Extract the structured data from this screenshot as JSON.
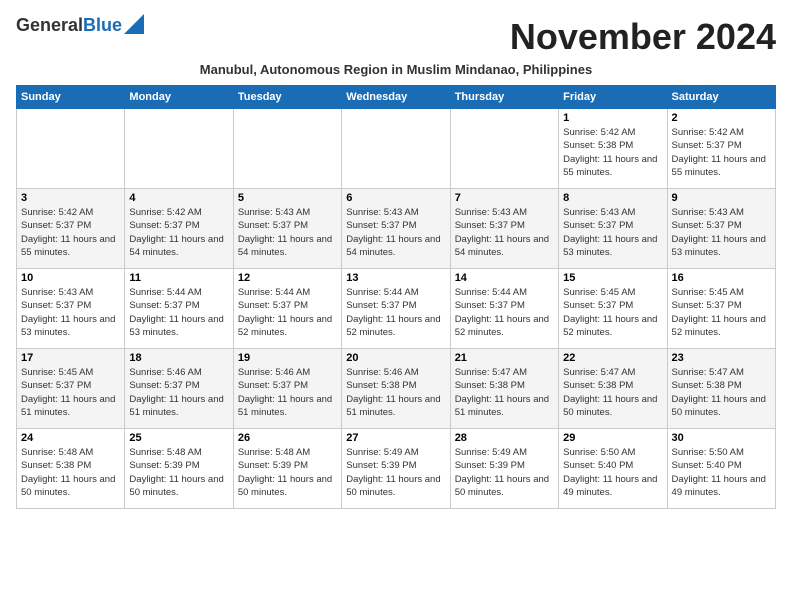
{
  "header": {
    "logo_line1": "General",
    "logo_line2": "Blue",
    "month_title": "November 2024",
    "subtitle": "Manubul, Autonomous Region in Muslim Mindanao, Philippines"
  },
  "days_of_week": [
    "Sunday",
    "Monday",
    "Tuesday",
    "Wednesday",
    "Thursday",
    "Friday",
    "Saturday"
  ],
  "weeks": [
    [
      {
        "day": "",
        "info": ""
      },
      {
        "day": "",
        "info": ""
      },
      {
        "day": "",
        "info": ""
      },
      {
        "day": "",
        "info": ""
      },
      {
        "day": "",
        "info": ""
      },
      {
        "day": "1",
        "info": "Sunrise: 5:42 AM\nSunset: 5:38 PM\nDaylight: 11 hours and 55 minutes."
      },
      {
        "day": "2",
        "info": "Sunrise: 5:42 AM\nSunset: 5:37 PM\nDaylight: 11 hours and 55 minutes."
      }
    ],
    [
      {
        "day": "3",
        "info": "Sunrise: 5:42 AM\nSunset: 5:37 PM\nDaylight: 11 hours and 55 minutes."
      },
      {
        "day": "4",
        "info": "Sunrise: 5:42 AM\nSunset: 5:37 PM\nDaylight: 11 hours and 54 minutes."
      },
      {
        "day": "5",
        "info": "Sunrise: 5:43 AM\nSunset: 5:37 PM\nDaylight: 11 hours and 54 minutes."
      },
      {
        "day": "6",
        "info": "Sunrise: 5:43 AM\nSunset: 5:37 PM\nDaylight: 11 hours and 54 minutes."
      },
      {
        "day": "7",
        "info": "Sunrise: 5:43 AM\nSunset: 5:37 PM\nDaylight: 11 hours and 54 minutes."
      },
      {
        "day": "8",
        "info": "Sunrise: 5:43 AM\nSunset: 5:37 PM\nDaylight: 11 hours and 53 minutes."
      },
      {
        "day": "9",
        "info": "Sunrise: 5:43 AM\nSunset: 5:37 PM\nDaylight: 11 hours and 53 minutes."
      }
    ],
    [
      {
        "day": "10",
        "info": "Sunrise: 5:43 AM\nSunset: 5:37 PM\nDaylight: 11 hours and 53 minutes."
      },
      {
        "day": "11",
        "info": "Sunrise: 5:44 AM\nSunset: 5:37 PM\nDaylight: 11 hours and 53 minutes."
      },
      {
        "day": "12",
        "info": "Sunrise: 5:44 AM\nSunset: 5:37 PM\nDaylight: 11 hours and 52 minutes."
      },
      {
        "day": "13",
        "info": "Sunrise: 5:44 AM\nSunset: 5:37 PM\nDaylight: 11 hours and 52 minutes."
      },
      {
        "day": "14",
        "info": "Sunrise: 5:44 AM\nSunset: 5:37 PM\nDaylight: 11 hours and 52 minutes."
      },
      {
        "day": "15",
        "info": "Sunrise: 5:45 AM\nSunset: 5:37 PM\nDaylight: 11 hours and 52 minutes."
      },
      {
        "day": "16",
        "info": "Sunrise: 5:45 AM\nSunset: 5:37 PM\nDaylight: 11 hours and 52 minutes."
      }
    ],
    [
      {
        "day": "17",
        "info": "Sunrise: 5:45 AM\nSunset: 5:37 PM\nDaylight: 11 hours and 51 minutes."
      },
      {
        "day": "18",
        "info": "Sunrise: 5:46 AM\nSunset: 5:37 PM\nDaylight: 11 hours and 51 minutes."
      },
      {
        "day": "19",
        "info": "Sunrise: 5:46 AM\nSunset: 5:37 PM\nDaylight: 11 hours and 51 minutes."
      },
      {
        "day": "20",
        "info": "Sunrise: 5:46 AM\nSunset: 5:38 PM\nDaylight: 11 hours and 51 minutes."
      },
      {
        "day": "21",
        "info": "Sunrise: 5:47 AM\nSunset: 5:38 PM\nDaylight: 11 hours and 51 minutes."
      },
      {
        "day": "22",
        "info": "Sunrise: 5:47 AM\nSunset: 5:38 PM\nDaylight: 11 hours and 50 minutes."
      },
      {
        "day": "23",
        "info": "Sunrise: 5:47 AM\nSunset: 5:38 PM\nDaylight: 11 hours and 50 minutes."
      }
    ],
    [
      {
        "day": "24",
        "info": "Sunrise: 5:48 AM\nSunset: 5:38 PM\nDaylight: 11 hours and 50 minutes."
      },
      {
        "day": "25",
        "info": "Sunrise: 5:48 AM\nSunset: 5:39 PM\nDaylight: 11 hours and 50 minutes."
      },
      {
        "day": "26",
        "info": "Sunrise: 5:48 AM\nSunset: 5:39 PM\nDaylight: 11 hours and 50 minutes."
      },
      {
        "day": "27",
        "info": "Sunrise: 5:49 AM\nSunset: 5:39 PM\nDaylight: 11 hours and 50 minutes."
      },
      {
        "day": "28",
        "info": "Sunrise: 5:49 AM\nSunset: 5:39 PM\nDaylight: 11 hours and 50 minutes."
      },
      {
        "day": "29",
        "info": "Sunrise: 5:50 AM\nSunset: 5:40 PM\nDaylight: 11 hours and 49 minutes."
      },
      {
        "day": "30",
        "info": "Sunrise: 5:50 AM\nSunset: 5:40 PM\nDaylight: 11 hours and 49 minutes."
      }
    ]
  ]
}
